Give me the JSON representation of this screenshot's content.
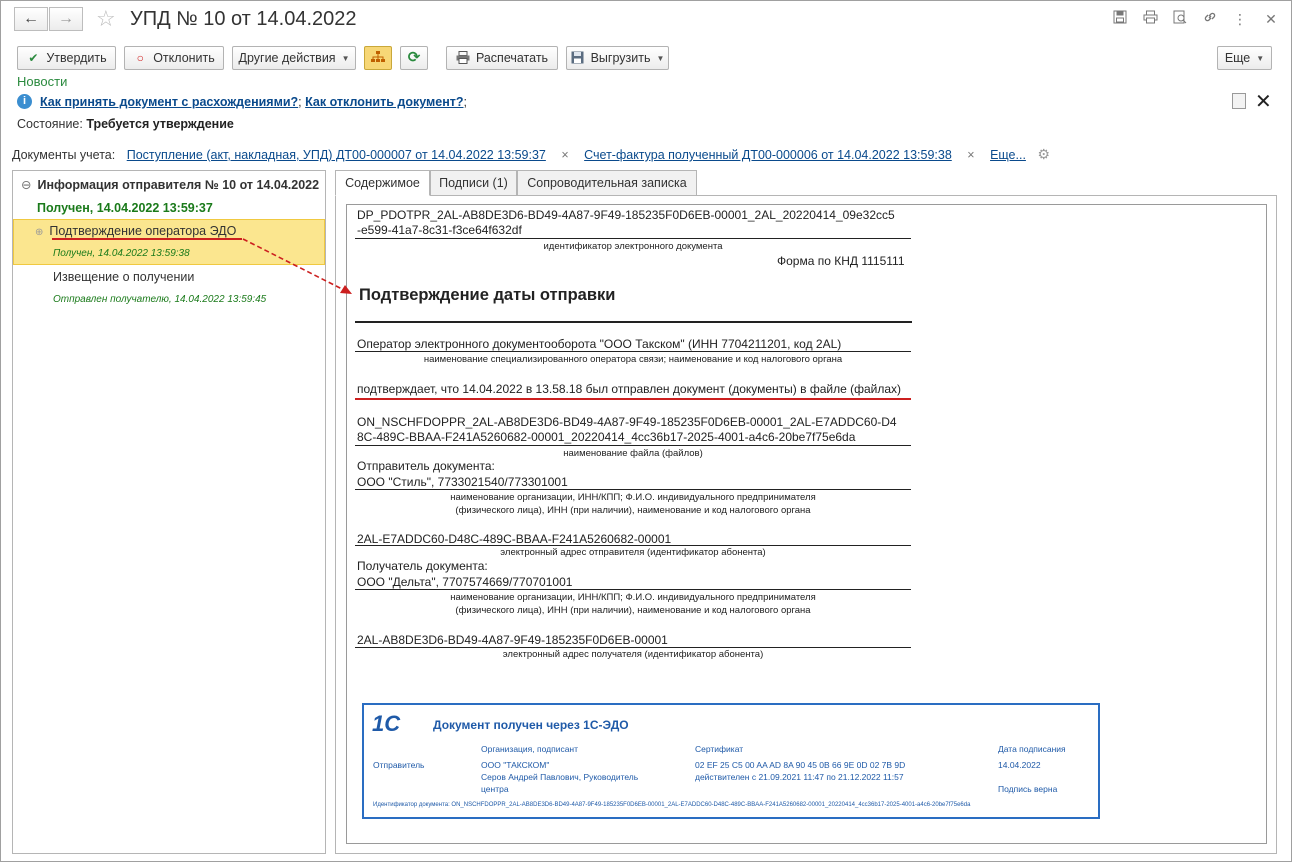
{
  "window": {
    "title": "УПД № 10 от 14.04.2022"
  },
  "toolbar": {
    "approve": "Утвердить",
    "reject": "Отклонить",
    "other_actions": "Другие действия",
    "print": "Распечатать",
    "export": "Выгрузить",
    "more": "Еще"
  },
  "news": "Новости",
  "hints": {
    "accept_link": "Как принять документ с расхождениями?",
    "reject_link": "Как отклонить документ?",
    "sep": ";",
    "end": ";"
  },
  "state": {
    "label": "Состояние:",
    "value": "Требуется утверждение"
  },
  "docs": {
    "label": "Документы учета:",
    "doc1": "Поступление (акт, накладная, УПД) ДТ00-000007 от 14.04.2022 13:59:37",
    "doc2": "Счет-фактура полученный ДТ00-000006 от 14.04.2022 13:59:38",
    "more": "Еще..."
  },
  "tree": {
    "head": "Информация отправителя № 10 от 14.04.2022",
    "received": "Получен, 14.04.2022 13:59:37",
    "items": [
      {
        "label": "Подтверждение оператора ЭДО",
        "date": "Получен, 14.04.2022 13:59:38"
      },
      {
        "label": "Извещение о получении",
        "date": "Отправлен получателю, 14.04.2022 13:59:45"
      }
    ]
  },
  "tabs": [
    "Содержимое",
    "Подписи (1)",
    "Сопроводительная записка"
  ],
  "sheet": {
    "doc_id_1": "DP_PDOTPR_2AL-AB8DE3D6-BD49-4A87-9F49-185235F0D6EB-00001_2AL_20220414_09e32cc5",
    "doc_id_2": "-e599-41a7-8c31-f3ce64f632df",
    "doc_id_cap": "идентификатор электронного документа",
    "form": "Форма по КНД 1115111",
    "heading": "Подтверждение даты отправки",
    "operator": "Оператор электронного документооборота \"ООО Такском\" (ИНН 7704211201, код 2AL)",
    "operator_cap": "наименование специализированного оператора связи; наименование и код налогового органа",
    "confirms": "подтверждает, что 14.04.2022 в 13.58.18 был отправлен документ (документы) в файле (файлах)",
    "file_1": "ON_NSCHFDOPPR_2AL-AB8DE3D6-BD49-4A87-9F49-185235F0D6EB-00001_2AL-E7ADDC60-D4",
    "file_2": "8C-489C-BBAA-F241A5260682-00001_20220414_4cc36b17-2025-4001-a4c6-20be7f75e6da",
    "file_cap": "наименование файла (файлов)",
    "sender_label": "Отправитель документа:",
    "sender": "ООО \"Стиль\", 7733021540/773301001",
    "org_cap_1": "наименование организации, ИНН/КПП; Ф.И.О. индивидуального предпринимателя",
    "org_cap_2": "(физического лица), ИНН (при наличии), наименование и код налогового органа",
    "sender_addr": "2AL-E7ADDC60-D48C-489C-BBAA-F241A5260682-00001",
    "sender_addr_cap": "электронный адрес отправителя (идентификатор абонента)",
    "recipient_label": "Получатель документа:",
    "recipient": "ООО \"Дельта\", 7707574669/770701001",
    "recipient_addr": "2AL-AB8DE3D6-BD49-4A87-9F49-185235F0D6EB-00001",
    "recipient_addr_cap": "электронный адрес получателя (идентификатор абонента)"
  },
  "stamp": {
    "logo": "1С",
    "title": "Документ получен через 1С-ЭДО",
    "col_org": "Организация, подписант",
    "col_cert": "Сертификат",
    "col_date": "Дата подписания",
    "role": "Отправитель",
    "org": "ООО \"ТАКСКОМ\"",
    "signer_1": "Серов Андрей Павлович, Руководитель",
    "signer_2": "центра",
    "cert": "02 EF 25 C5 00 AA AD 8A 90 45 0B 66 9E 0D 02 7B 9D",
    "valid": "действителен с 21.09.2021 11:47 по 21.12.2022 11:57",
    "date": "14.04.2022",
    "sig_ok": "Подпись верна",
    "doc_id": "Идентификатор документа: ON_NSCHFDOPPR_2AL-AB8DE3D6-BD49-4A87-9F49-185235F0D6EB-00001_2AL-E7ADDC60-D48C-489C-BBAA-F241A5260682-00001_20220414_4cc36b17-2025-4001-a4c6-20be7f75e6da"
  },
  "colors": {
    "accent_link": "#0a4a8c",
    "news": "#2a8a3e",
    "selection": "#fbe68f",
    "stamp": "#2a6dc2",
    "annotation": "#cc1f1f"
  }
}
